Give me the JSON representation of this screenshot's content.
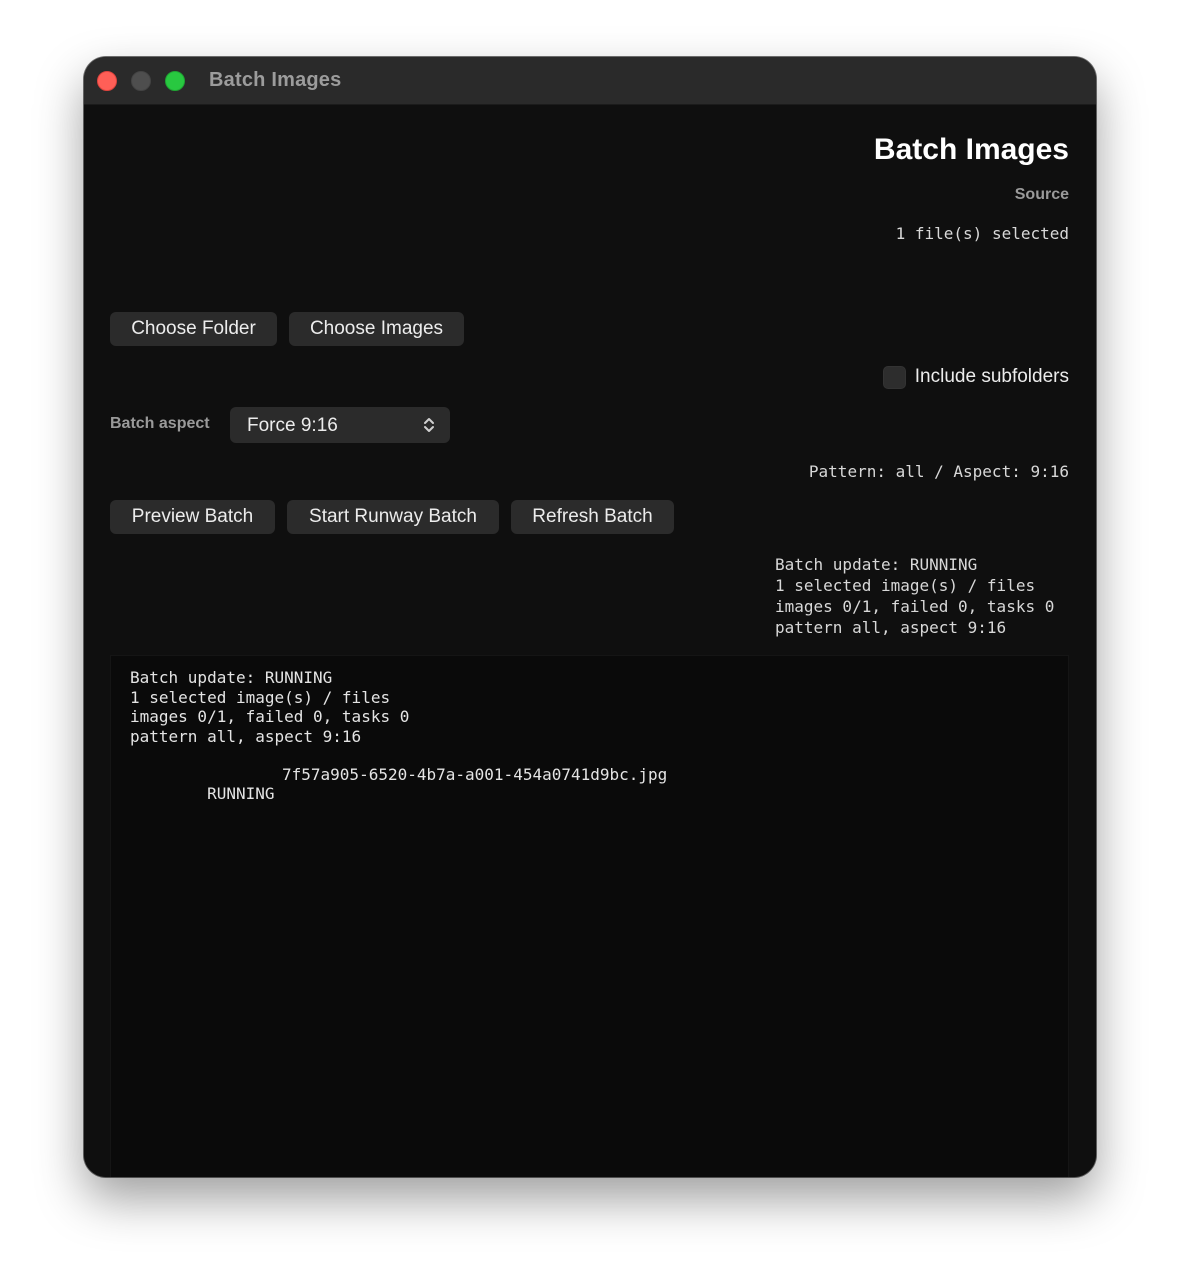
{
  "window": {
    "title": "Batch Images"
  },
  "header": {
    "title": "Batch Images",
    "source_label": "Source",
    "files_selected": "1 file(s) selected"
  },
  "source_buttons": {
    "choose_folder": "Choose Folder",
    "choose_images": "Choose Images"
  },
  "options": {
    "include_subfolders_label": "Include subfolders",
    "include_subfolders_checked": false,
    "batch_aspect_label": "Batch aspect",
    "batch_aspect_value": "Force 9:16",
    "pattern_summary": "Pattern: all / Aspect: 9:16"
  },
  "actions": {
    "preview": "Preview Batch",
    "start": "Start Runway Batch",
    "refresh": "Refresh Batch"
  },
  "status_summary": {
    "lines": [
      "Batch update: RUNNING",
      "1 selected image(s) / files",
      "images 0/1, failed 0, tasks 0",
      "pattern all, aspect 9:16"
    ]
  },
  "log": {
    "lines": [
      "Batch update: RUNNING",
      "1 selected image(s) / files",
      "images 0/1, failed 0, tasks 0",
      "pattern all, aspect 9:16"
    ],
    "rows": [
      {
        "status": "RUNNING",
        "file": "7f57a905-6520-4b7a-a001-454a0741d9bc.jpg"
      }
    ]
  },
  "icons": {
    "close": "close-icon",
    "minimize": "minimize-icon",
    "maximize": "maximize-icon",
    "select_chevron": "chevron-up-down-icon"
  },
  "colors": {
    "window_bg": "#0f0f0f",
    "titlebar_bg": "#2a2a2a",
    "button_bg": "#2b2b2b",
    "close": "#ff5f57",
    "maximize": "#28c840"
  }
}
